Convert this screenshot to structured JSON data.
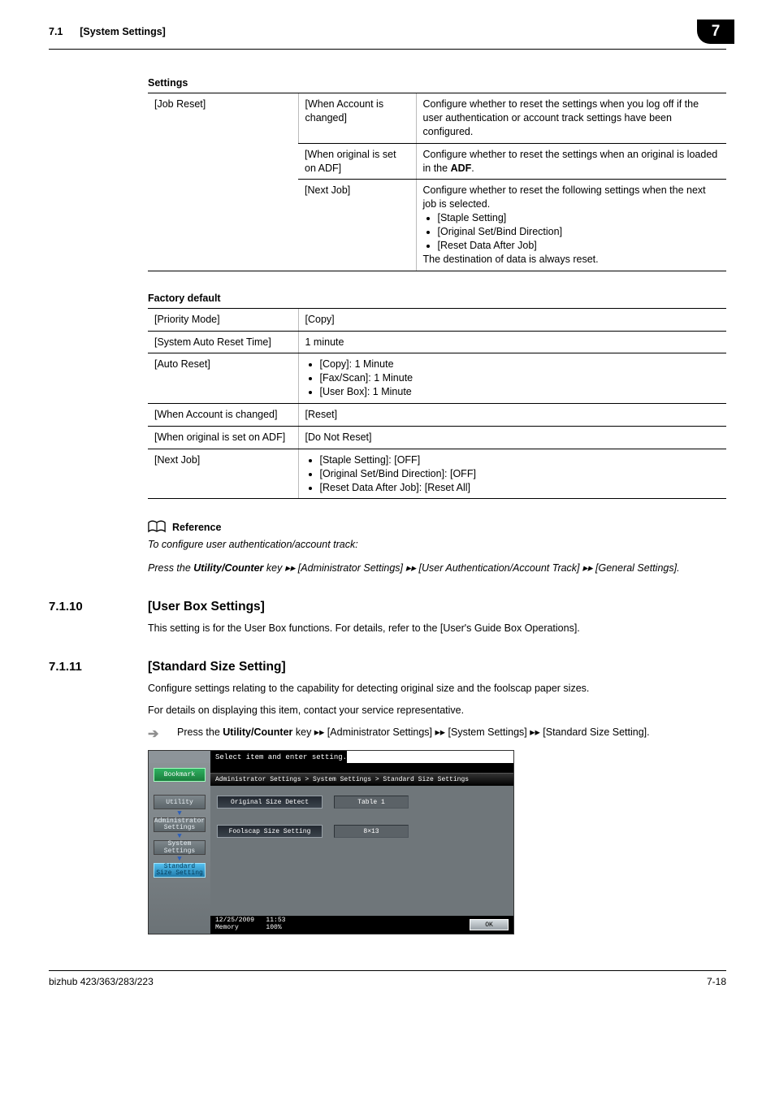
{
  "header": {
    "section_no": "7.1",
    "section_title": "[System Settings]",
    "chapter": "7"
  },
  "settings_table": {
    "title": "Settings",
    "col0_label": "[Job Reset]",
    "rows": [
      {
        "opt": "[When Account is changed]",
        "desc_lines": [
          "Configure whether to reset the settings when you log off if the user authentication or account track settings have been configured."
        ]
      },
      {
        "opt": "[When original is set on ADF]",
        "desc_lines": [
          "Configure whether to reset the settings when an original is loaded in the "
        ],
        "desc_bold": "ADF",
        "desc_after": "."
      },
      {
        "opt": "[Next Job]",
        "desc_lines": [
          "Configure whether to reset the following settings when the next job is selected."
        ],
        "desc_bullets": [
          "[Staple Setting]",
          "[Original Set/Bind Direction]",
          "[Reset Data After Job]"
        ],
        "desc_tail": "The destination of data is always reset."
      }
    ]
  },
  "factory_table": {
    "title": "Factory default",
    "rows": [
      {
        "k": "[Priority Mode]",
        "v_text": "[Copy]"
      },
      {
        "k": "[System Auto Reset Time]",
        "v_text": "1 minute"
      },
      {
        "k": "[Auto Reset]",
        "v_bullets": [
          "[Copy]: 1 Minute",
          "[Fax/Scan]: 1 Minute",
          "[User Box]: 1 Minute"
        ]
      },
      {
        "k": "[When Account is changed]",
        "v_text": "[Reset]"
      },
      {
        "k": "[When original is set on ADF]",
        "v_text": "[Do Not Reset]"
      },
      {
        "k": "[Next Job]",
        "v_bullets": [
          "[Staple Setting]: [OFF]",
          "[Original Set/Bind Direction]: [OFF]",
          "[Reset Data After Job]: [Reset All]"
        ]
      }
    ]
  },
  "reference": {
    "title": "Reference",
    "line1": "To configure user authentication/account track:",
    "line2_pre": "Press the ",
    "line2_bold": "Utility/Counter",
    "line2_post": " key ▸▸ [Administrator Settings] ▸▸ [User Authentication/Account Track] ▸▸ [General Settings]."
  },
  "sec_7110": {
    "num": "7.1.10",
    "title": "[User Box Settings]",
    "body": "This setting is for the User Box functions. For details, refer to the [User's Guide Box Operations]."
  },
  "sec_7111": {
    "num": "7.1.11",
    "title": "[Standard Size Setting]",
    "body1": "Configure settings relating to the capability for detecting original size and the foolscap paper sizes.",
    "body2": "For details on displaying this item, contact your service representative.",
    "step_pre": "Press the ",
    "step_bold": "Utility/Counter",
    "step_post": " key ▸▸ [Administrator Settings] ▸▸ [System Settings] ▸▸ [Standard Size Setting]."
  },
  "screenshot": {
    "topbar": "Select item and enter setting.",
    "breadcrumb": "Administrator Settings > System Settings > Standard Size Settings",
    "bookmark": "Bookmark",
    "crumbs": [
      "Utility",
      "Administrator Settings",
      "System Settings",
      "Standard Size Setting"
    ],
    "opt1_label": "Original Size Detect",
    "opt1_value": "Table 1",
    "opt2_label": "Foolscap Size Setting",
    "opt2_value": "8×13",
    "footer_date": "12/25/2009",
    "footer_time": "11:53",
    "footer_mem_label": "Memory",
    "footer_mem_value": "100%",
    "ok": "OK"
  },
  "footer": {
    "product": "bizhub 423/363/283/223",
    "page": "7-18"
  }
}
